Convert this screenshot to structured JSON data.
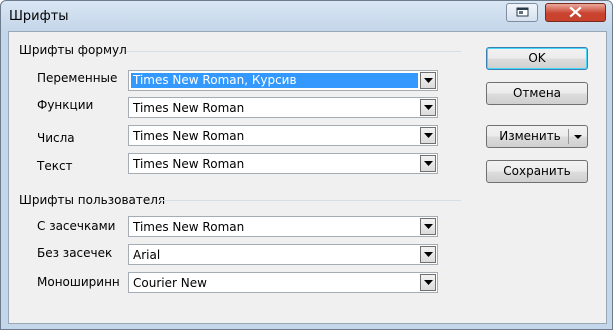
{
  "window": {
    "title": "Шрифты"
  },
  "formula_fonts": {
    "title": "Шрифты формул",
    "rows": [
      {
        "label": "Переменные",
        "value": "Times New Roman, Курсив"
      },
      {
        "label": "Функции",
        "value": "Times New Roman"
      },
      {
        "label": "Числа",
        "value": "Times New Roman"
      },
      {
        "label": "Текст",
        "value": "Times New Roman"
      }
    ]
  },
  "custom_fonts": {
    "title": "Шрифты пользователя",
    "rows": [
      {
        "label": "С засечками",
        "value": "Times New Roman"
      },
      {
        "label": "Без засечек",
        "value": "Arial"
      },
      {
        "label": "Моноширинн",
        "value": "Courier New"
      }
    ]
  },
  "buttons": {
    "ok": "OK",
    "cancel": "Отмена",
    "modify": "Изменить",
    "save": "Сохранить"
  },
  "colors": {
    "selection": "#3399ff",
    "close_button": "#c7412c"
  },
  "icons": [
    "help-icon",
    "close-icon",
    "dropdown-arrow-icon"
  ]
}
